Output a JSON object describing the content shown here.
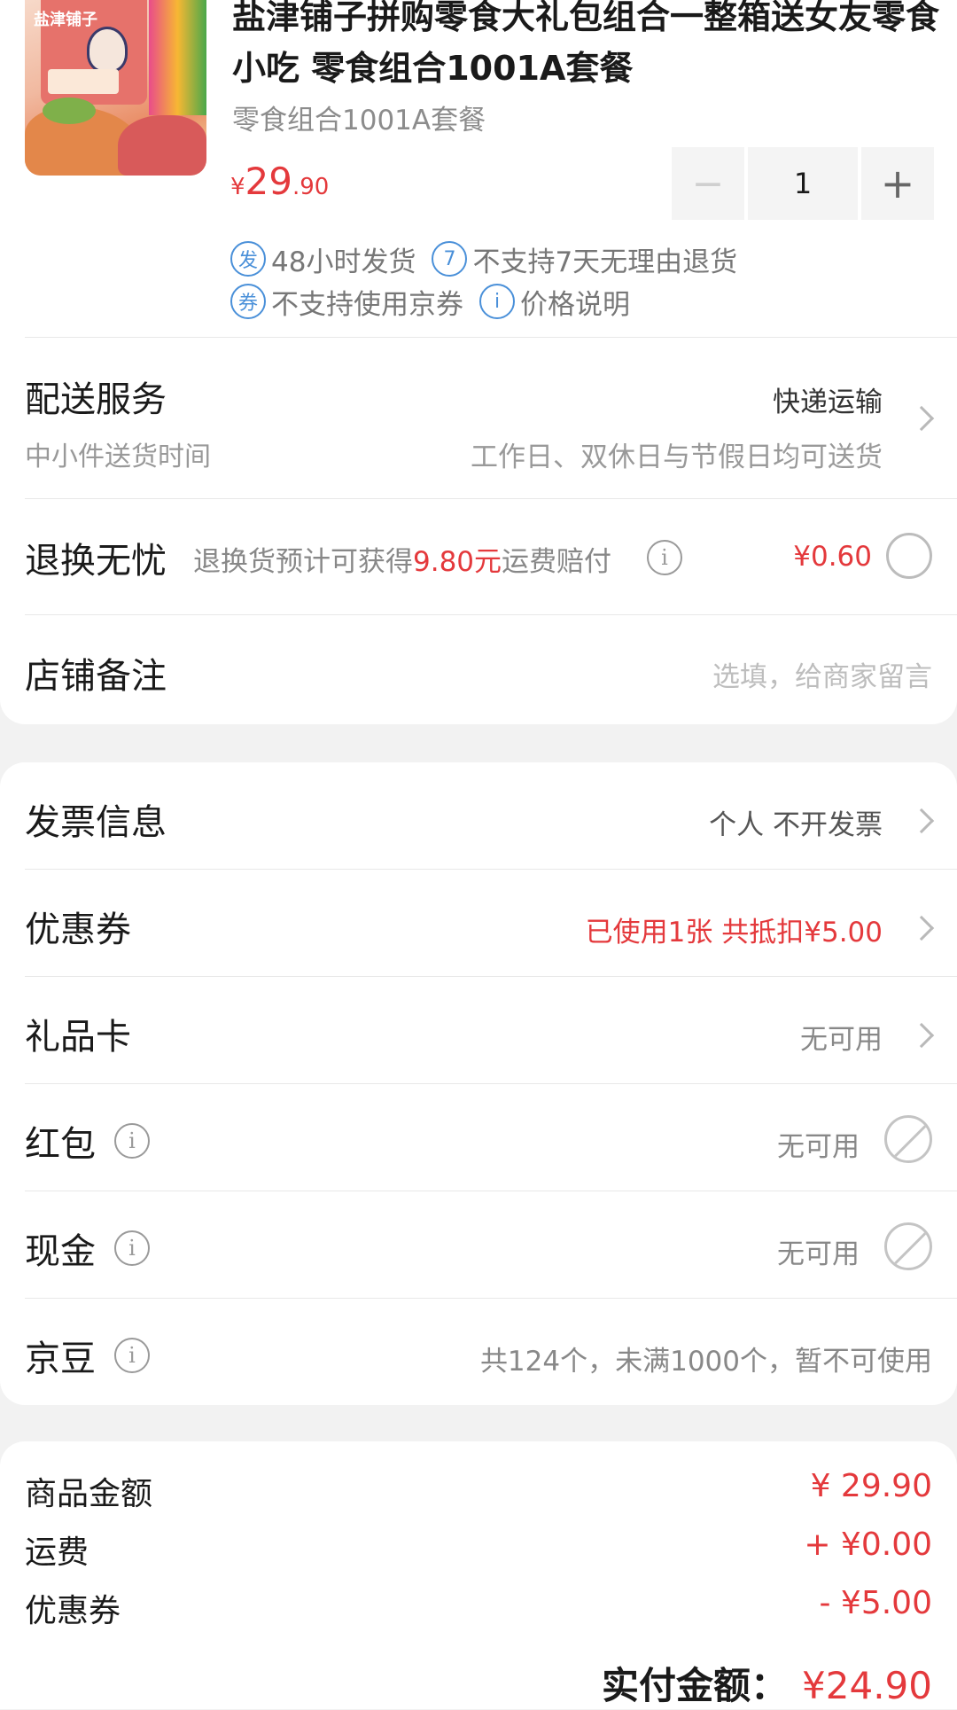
{
  "product": {
    "brand_text": "盐津铺子",
    "title": "盐津铺子拼购零食大礼包组合一整箱送女友零食小吃 零食组合1001A套餐",
    "spec": "零食组合1001A套餐",
    "price_symbol": "¥",
    "price_int": "29",
    "price_dec": ".90",
    "quantity": "1",
    "minus": "−",
    "plus": "+",
    "tags": [
      {
        "icon": "发",
        "label": "48小时发货"
      },
      {
        "icon": "7",
        "label": "不支持7天无理由退货"
      },
      {
        "icon": "券",
        "label": "不支持使用京券"
      },
      {
        "icon": "i",
        "label": "价格说明"
      }
    ]
  },
  "delivery": {
    "title": "配送服务",
    "method": "快递运输",
    "sub_label": "中小件送货时间",
    "sub_value": "工作日、双休日与节假日均可送货"
  },
  "returns": {
    "title": "退换无忧",
    "desc_prefix": "退换货预计可获得",
    "desc_amount": "9.80元",
    "desc_suffix": "运费赔付",
    "price": "¥0.60"
  },
  "note": {
    "title": "店铺备注",
    "placeholder": "选填，给商家留言"
  },
  "invoice": {
    "title": "发票信息",
    "value": "个人 不开发票"
  },
  "coupon": {
    "title": "优惠券",
    "value": "已使用1张 共抵扣¥5.00"
  },
  "giftcard": {
    "title": "礼品卡",
    "value": "无可用"
  },
  "redpacket": {
    "title": "红包",
    "value": "无可用"
  },
  "cash": {
    "title": "现金",
    "value": "无可用"
  },
  "jingdou": {
    "title": "京豆",
    "value": "共124个，未满1000个，暂不可使用"
  },
  "summary": {
    "items": [
      {
        "label": "商品金额",
        "value": "¥ 29.90"
      },
      {
        "label": "运费",
        "value": "+ ¥0.00"
      },
      {
        "label": "优惠券",
        "value": "- ¥5.00"
      }
    ],
    "total_label": "实付金额：",
    "total_value": "¥24.90"
  },
  "colors": {
    "accent": "#e4393c",
    "tag_blue": "#4a90d9"
  }
}
